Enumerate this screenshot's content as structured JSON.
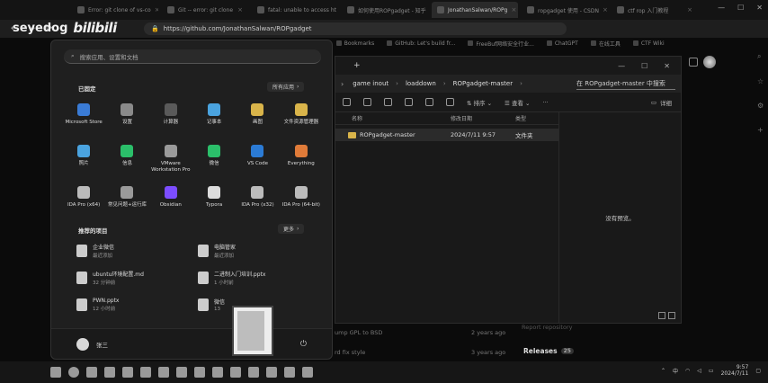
{
  "watermark": {
    "user": "seyedog",
    "logo": "bilibili"
  },
  "browser": {
    "tabs": [
      {
        "label": "Error: git clone of vs-co",
        "active": false
      },
      {
        "label": "Git -- error: git clone",
        "active": false
      },
      {
        "label": "fatal: unable to access ht",
        "active": false
      },
      {
        "label": "如何使用ROPgadget - 知乎",
        "active": false
      },
      {
        "label": "JonathanSalwan/ROPg",
        "active": true
      },
      {
        "label": "ropgadget 使用 - CSDN",
        "active": false
      },
      {
        "label": "ctf rop 入门教程",
        "active": false
      }
    ],
    "url": "https://github.com/JonathanSalwan/ROPgadget",
    "bookmarks": [
      "Luo",
      "Bookmarks",
      "GitHub: Let's build fr...",
      "FreeBuf网络安全行业...",
      "ChatGPT",
      "在线工具",
      "CTF Wiki"
    ]
  },
  "github_behind": {
    "row1_text": "ump GPL to BSD",
    "row1_time": "2 years ago",
    "row2_text": "rd fix style",
    "row2_time": "3 years ago",
    "report": "Report repository",
    "releases_label": "Releases",
    "releases_count": "25"
  },
  "explorer": {
    "breadcrumb": [
      "game inout",
      "loaddown",
      "ROPgadget-master"
    ],
    "search_placeholder": "在 ROPgadget-master 中搜索",
    "commands": {
      "sort": "排序",
      "view": "查看",
      "more": "···",
      "details": "详细"
    },
    "columns": {
      "name": "名称",
      "date": "修改日期",
      "type": "类型"
    },
    "rows": [
      {
        "name": "ROPgadget-master",
        "date": "2024/7/11 9:57",
        "type": "文件夹"
      }
    ],
    "preview_text": "没有预览。"
  },
  "start_menu": {
    "search_placeholder": "搜索应用、设置和文档",
    "pinned_title": "已固定",
    "all_apps": "所有应用",
    "apps": [
      "Microsoft Store",
      "设置",
      "计算器",
      "记事本",
      "画图",
      "文件资源管理器",
      "照片",
      "信息",
      "VMware Workstation Pro",
      "微信",
      "VS Code",
      "Everything",
      "IDA Pro (x64)",
      "常见问题+运行库",
      "Obsidian",
      "Typora",
      "IDA Pro (x32)",
      "IDA Pro (64-bit)"
    ],
    "recommended_title": "推荐的项目",
    "more": "更多",
    "recommended": [
      {
        "name": "企业微信",
        "time": "最近添加"
      },
      {
        "name": "电脑管家",
        "time": "最近添加"
      },
      {
        "name": "ubuntu环境配置.md",
        "time": "32 分钟前"
      },
      {
        "name": "二进制入门培训.pptx",
        "time": "1 小时前"
      },
      {
        "name": "PWN.pptx",
        "time": "12 小时前"
      },
      {
        "name": "微信",
        "time": "13"
      }
    ],
    "user_name": "张三",
    "power_icon": "power-icon"
  },
  "taskbar": {
    "time": "9:57",
    "date": "2024/7/11",
    "tray_lang": "中"
  }
}
